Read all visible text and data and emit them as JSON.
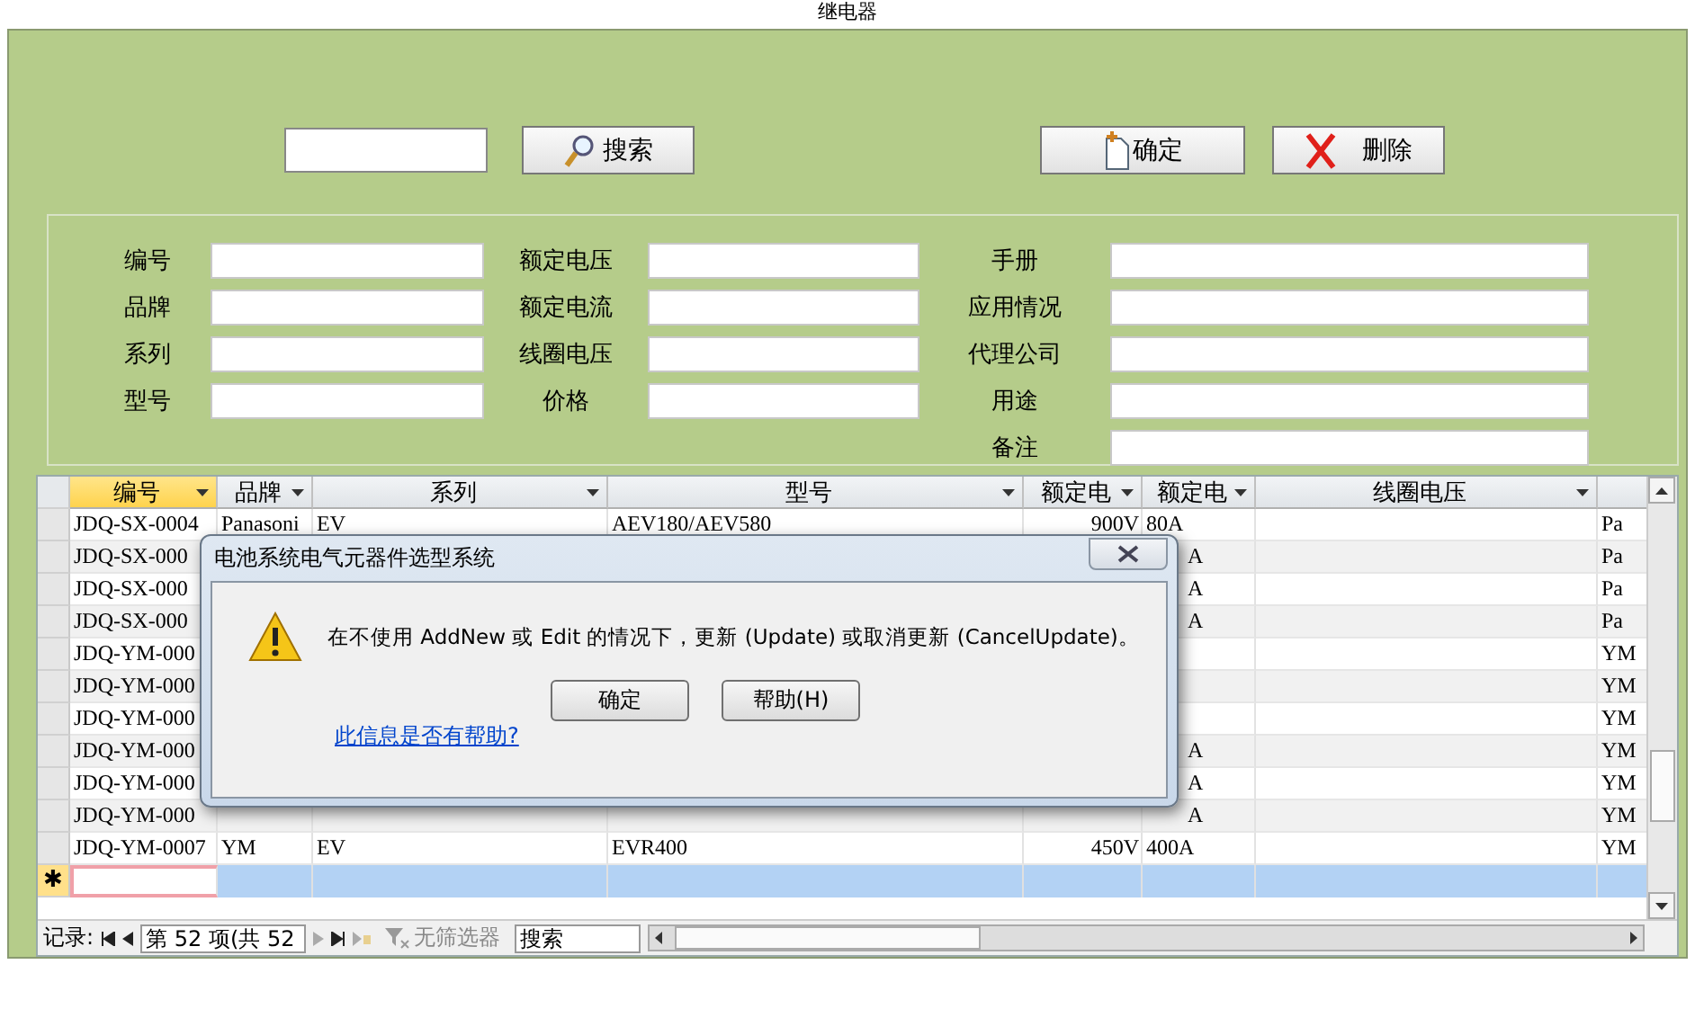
{
  "window": {
    "title": "继电器"
  },
  "toolbar": {
    "search_button": "搜索",
    "buttons": [
      {
        "label": "确定",
        "kind": "new"
      },
      {
        "label": "删除",
        "kind": "delete"
      }
    ]
  },
  "form": {
    "columns": [
      [
        {
          "label": "编号"
        },
        {
          "label": "品牌"
        },
        {
          "label": "系列"
        },
        {
          "label": "型号"
        }
      ],
      [
        {
          "label": "额定电压"
        },
        {
          "label": "额定电流"
        },
        {
          "label": "线圈电压"
        },
        {
          "label": "价格"
        }
      ],
      [
        {
          "label": "手册"
        },
        {
          "label": "应用情况"
        },
        {
          "label": "代理公司"
        },
        {
          "label": "用途"
        },
        {
          "label": "备注"
        }
      ]
    ]
  },
  "grid": {
    "columns": [
      {
        "label": "编号",
        "selected": true
      },
      {
        "label": "品牌",
        "selected": false
      },
      {
        "label": "系列",
        "selected": false
      },
      {
        "label": "型号",
        "selected": false
      },
      {
        "label": "额定电",
        "selected": false
      },
      {
        "label": "额定电",
        "selected": false
      },
      {
        "label": "线圈电压",
        "selected": false
      },
      {
        "selected": false
      }
    ],
    "rows": [
      {
        "cells": [
          "JDQ-SX-0004",
          "Panasoni",
          "EV",
          "AEV180/AEV580",
          "900V",
          "80A",
          "",
          "Pa"
        ]
      },
      {
        "under_dialog": true,
        "cells": [
          "JDQ-SX-000",
          "",
          "",
          "",
          "",
          "A",
          "",
          "Pa"
        ]
      },
      {
        "under_dialog": true,
        "cells": [
          "JDQ-SX-000",
          "",
          "",
          "",
          "",
          "A",
          "",
          "Pa"
        ]
      },
      {
        "under_dialog": true,
        "cells": [
          "JDQ-SX-000",
          "",
          "",
          "",
          "",
          "A",
          "",
          "Pa"
        ]
      },
      {
        "cells": [
          "JDQ-YM-000",
          "",
          "",
          "",
          "",
          "",
          "",
          "YM"
        ]
      },
      {
        "cells": [
          "JDQ-YM-000",
          "",
          "",
          "",
          "",
          "",
          "",
          "YM"
        ]
      },
      {
        "cells": [
          "JDQ-YM-000",
          "",
          "",
          "",
          "",
          "",
          "",
          "YM"
        ]
      },
      {
        "under_dialog": true,
        "cells": [
          "JDQ-YM-000",
          "",
          "",
          "",
          "",
          "A",
          "",
          "YM"
        ]
      },
      {
        "under_dialog": true,
        "cells": [
          "JDQ-YM-000",
          "",
          "",
          "",
          "",
          "A",
          "",
          "YM"
        ]
      },
      {
        "under_dialog": true,
        "cells": [
          "JDQ-YM-000",
          "",
          "",
          "",
          "",
          "A",
          "",
          "YM"
        ]
      },
      {
        "cells": [
          "JDQ-YM-0007",
          "YM",
          "EV",
          "EVR400",
          "450V",
          "400A",
          "",
          "YM"
        ]
      }
    ],
    "new_row_marker": "✱"
  },
  "nav": {
    "label": "记录:",
    "position": "第 52 项(共 52",
    "filter": "无筛选器",
    "search": "搜索"
  },
  "dialog": {
    "title": "电池系统电气元器件选型系统",
    "message": "在不使用 AddNew 或 Edit 的情况下，更新 (Update) 或取消更新 (CancelUpdate)。",
    "buttons": [
      "确定",
      "帮助(H)"
    ],
    "link": "此信息是否有帮助?"
  }
}
